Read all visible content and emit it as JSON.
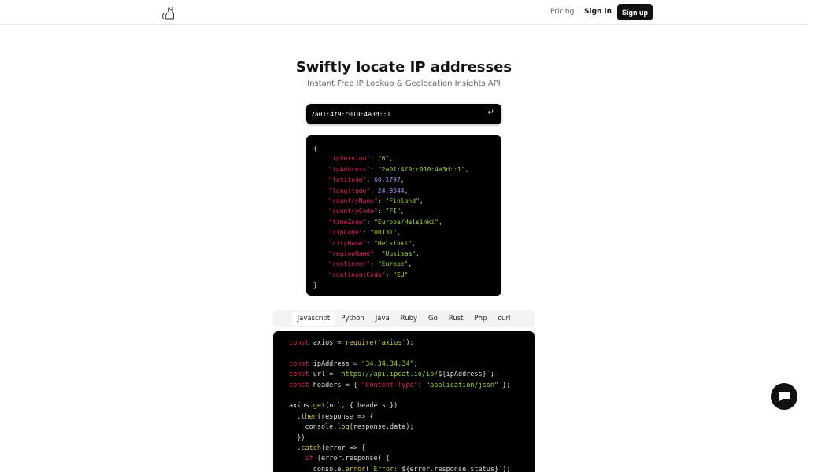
{
  "header": {
    "pricing": "Pricing",
    "sign_in": "Sign in",
    "sign_up": "Sign up"
  },
  "hero": {
    "title": "Swiftly locate IP addresses",
    "subtitle": "Instant Free IP Lookup & Geolocation Insights API"
  },
  "search": {
    "value": "2a01:4f9:c010:4a3d::1",
    "enter_icon": "↵"
  },
  "json_result": [
    [
      [
        "{",
        "p"
      ]
    ],
    [
      [
        "    \"ipVersion\"",
        "k"
      ],
      [
        ": ",
        "p"
      ],
      [
        "\"6\"",
        "s"
      ],
      [
        ",",
        "p"
      ]
    ],
    [
      [
        "    \"ipAddress\"",
        "k"
      ],
      [
        ": ",
        "p"
      ],
      [
        "\"2a01:4f9:c010:4a3d::1\"",
        "s"
      ],
      [
        ",",
        "p"
      ]
    ],
    [
      [
        "    \"latitude\"",
        "k"
      ],
      [
        ": ",
        "p"
      ],
      [
        "60.1797",
        "n"
      ],
      [
        ",",
        "p"
      ]
    ],
    [
      [
        "    \"longitude\"",
        "k"
      ],
      [
        ": ",
        "p"
      ],
      [
        "24.9344",
        "n"
      ],
      [
        ",",
        "p"
      ]
    ],
    [
      [
        "    \"countryName\"",
        "k"
      ],
      [
        ": ",
        "p"
      ],
      [
        "\"Finland\"",
        "s"
      ],
      [
        ",",
        "p"
      ]
    ],
    [
      [
        "    \"countryCode\"",
        "k"
      ],
      [
        ": ",
        "p"
      ],
      [
        "\"FI\"",
        "s"
      ],
      [
        ",",
        "p"
      ]
    ],
    [
      [
        "    \"timeZone\"",
        "k"
      ],
      [
        ": ",
        "p"
      ],
      [
        "\"Europe/Helsinki\"",
        "s"
      ],
      [
        ",",
        "p"
      ]
    ],
    [
      [
        "    \"zipCode\"",
        "k"
      ],
      [
        ": ",
        "p"
      ],
      [
        "\"00131\"",
        "s"
      ],
      [
        ",",
        "p"
      ]
    ],
    [
      [
        "    \"cityName\"",
        "k"
      ],
      [
        ": ",
        "p"
      ],
      [
        "\"Helsinki\"",
        "s"
      ],
      [
        ",",
        "p"
      ]
    ],
    [
      [
        "    \"regionName\"",
        "k"
      ],
      [
        ": ",
        "p"
      ],
      [
        "\"Uusimaa\"",
        "s"
      ],
      [
        ",",
        "p"
      ]
    ],
    [
      [
        "    \"continent\"",
        "k"
      ],
      [
        ": ",
        "p"
      ],
      [
        "\"Europe\"",
        "s"
      ],
      [
        ",",
        "p"
      ]
    ],
    [
      [
        "    \"continentCode\"",
        "k"
      ],
      [
        ": ",
        "p"
      ],
      [
        "\"EU\"",
        "s"
      ]
    ],
    [
      [
        "}",
        "p"
      ]
    ]
  ],
  "tabs": [
    "Javascript",
    "Python",
    "Java",
    "Ruby",
    "Go",
    "Rust",
    "Php",
    "curl"
  ],
  "active_tab": "Javascript",
  "code": [
    [
      [
        "const",
        "k"
      ],
      [
        " axios = ",
        "p"
      ],
      [
        "require",
        "f"
      ],
      [
        "(",
        "p"
      ],
      [
        "'axios'",
        "s"
      ],
      [
        ");",
        "p"
      ]
    ],
    [],
    [
      [
        "const",
        "k"
      ],
      [
        " ipAddress = ",
        "p"
      ],
      [
        "\"34.34.34.34\"",
        "s"
      ],
      [
        ";",
        "p"
      ]
    ],
    [
      [
        "const",
        "k"
      ],
      [
        " url = ",
        "p"
      ],
      [
        "`https://api.ipcat.io/ip/",
        "s"
      ],
      [
        "${ipAddress}",
        "p"
      ],
      [
        "`",
        "s"
      ],
      [
        ";",
        "p"
      ]
    ],
    [
      [
        "const",
        "k"
      ],
      [
        " headers = { ",
        "p"
      ],
      [
        "\"Content-Type\"",
        "k"
      ],
      [
        ": ",
        "p"
      ],
      [
        "\"application/json\"",
        "s"
      ],
      [
        " };",
        "p"
      ]
    ],
    [],
    [
      [
        "axios.",
        "p"
      ],
      [
        "get",
        "f"
      ],
      [
        "(url, { headers })",
        "p"
      ]
    ],
    [
      [
        "  .",
        "p"
      ],
      [
        "then",
        "f"
      ],
      [
        "(response => {",
        "p"
      ]
    ],
    [
      [
        "    console.",
        "p"
      ],
      [
        "log",
        "f"
      ],
      [
        "(response.data);",
        "p"
      ]
    ],
    [
      [
        "  })",
        "p"
      ]
    ],
    [
      [
        "  .",
        "p"
      ],
      [
        "catch",
        "f"
      ],
      [
        "(error => {",
        "p"
      ]
    ],
    [
      [
        "    ",
        "p"
      ],
      [
        "if",
        "k"
      ],
      [
        " (error.response) {",
        "p"
      ]
    ],
    [
      [
        "      console.",
        "p"
      ],
      [
        "error",
        "f"
      ],
      [
        "(",
        "p"
      ],
      [
        "`Error: ",
        "s"
      ],
      [
        "${error.response.status}",
        "p"
      ],
      [
        "`",
        "s"
      ],
      [
        ");",
        "p"
      ]
    ]
  ]
}
